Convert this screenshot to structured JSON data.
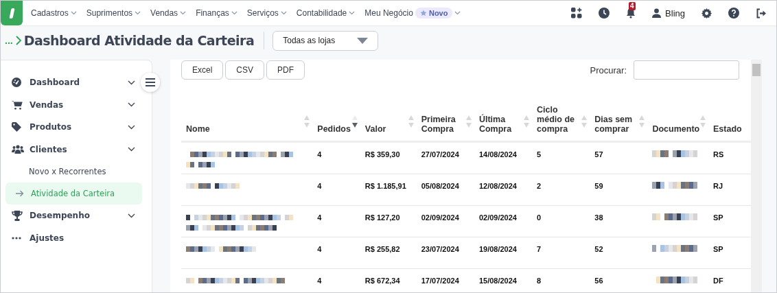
{
  "top_nav": {
    "menus": [
      {
        "label": "Cadastros"
      },
      {
        "label": "Suprimentos"
      },
      {
        "label": "Vendas"
      },
      {
        "label": "Finanças"
      },
      {
        "label": "Serviços"
      },
      {
        "label": "Contabilidade"
      },
      {
        "label": "Meu Negócio",
        "badge": "Novo"
      }
    ],
    "notifications": "4",
    "user": "Bling"
  },
  "breadcrumb": "...",
  "page_title": "Dashboard Atividade da Carteira",
  "store_select": "Todas as lojas",
  "sidebar": {
    "items": [
      {
        "label": "Dashboard",
        "expandable": true,
        "selected": false
      },
      {
        "label": "Vendas",
        "expandable": true,
        "selected": false
      },
      {
        "label": "Produtos",
        "expandable": true,
        "selected": false
      },
      {
        "label": "Clientes",
        "expandable": true,
        "selected": false,
        "children": [
          {
            "label": "Novo x Recorrentes",
            "selected": false
          },
          {
            "label": "Atividade da Carteira",
            "selected": true
          }
        ]
      },
      {
        "label": "Desempenho",
        "expandable": true,
        "selected": false
      },
      {
        "label": "Ajustes",
        "expandable": false,
        "selected": false
      }
    ]
  },
  "export_buttons": [
    "Excel",
    "CSV",
    "PDF"
  ],
  "search": {
    "label": "Procurar:"
  },
  "table": {
    "columns": [
      {
        "label": "Nome",
        "sortable": true,
        "sorted": false
      },
      {
        "label": "Pedidos",
        "sortable": true,
        "sorted": true
      },
      {
        "label": "Valor",
        "sortable": true,
        "sorted": false
      },
      {
        "label": "Primeira Compra",
        "sortable": true,
        "sorted": false
      },
      {
        "label": "Última Compra",
        "sortable": true,
        "sorted": false
      },
      {
        "label": "Ciclo médio de compra",
        "sortable": true,
        "sorted": false
      },
      {
        "label": "Dias sem comprar",
        "sortable": true,
        "sorted": false
      },
      {
        "label": "Documento",
        "sortable": true,
        "sorted": false
      },
      {
        "label": "Estado",
        "sortable": false
      }
    ],
    "rows": [
      {
        "pedidos": "4",
        "valor": "R$ 359,30",
        "primeira": "27/07/2024",
        "ultima": "14/08/2024",
        "ciclo": "5",
        "dias": "57",
        "estado": "RS"
      },
      {
        "pedidos": "4",
        "valor": "R$ 1.185,91",
        "primeira": "05/08/2024",
        "ultima": "12/08/2024",
        "ciclo": "2",
        "dias": "59",
        "estado": "RJ"
      },
      {
        "pedidos": "4",
        "valor": "R$ 127,20",
        "primeira": "02/09/2024",
        "ultima": "02/09/2024",
        "ciclo": "0",
        "dias": "38",
        "estado": "SP"
      },
      {
        "pedidos": "4",
        "valor": "R$ 255,82",
        "primeira": "23/07/2024",
        "ultima": "19/08/2024",
        "ciclo": "7",
        "dias": "52",
        "estado": "SP"
      },
      {
        "pedidos": "4",
        "valor": "R$ 672,34",
        "primeira": "17/07/2024",
        "ultima": "15/08/2024",
        "ciclo": "8",
        "dias": "56",
        "estado": "DF"
      }
    ]
  }
}
